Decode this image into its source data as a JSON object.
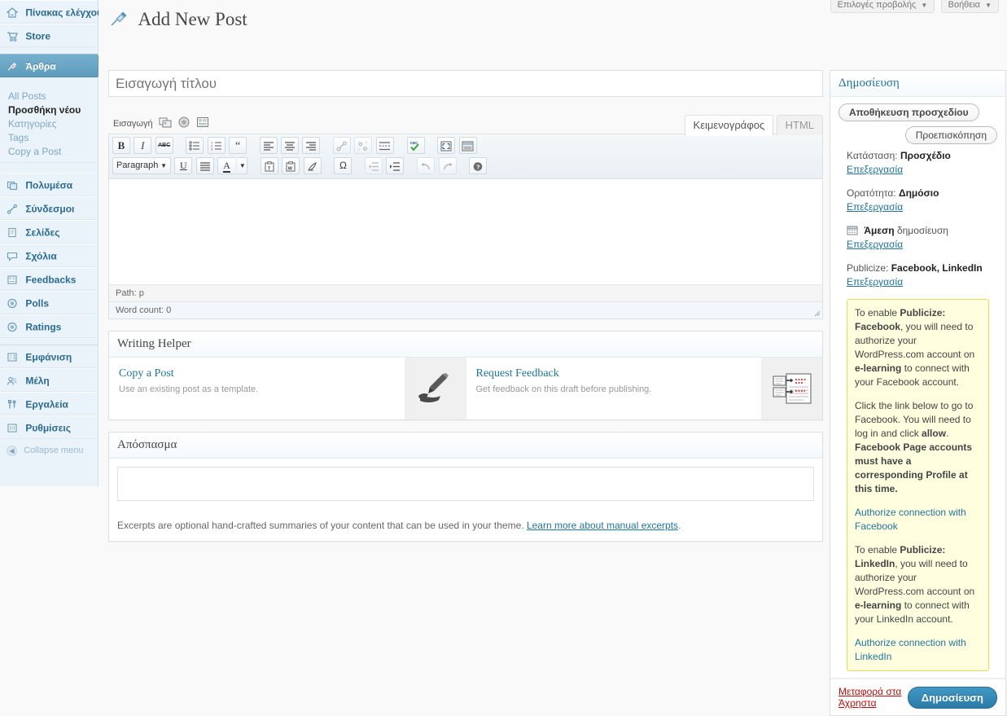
{
  "sidebar": {
    "items": [
      {
        "label": "Πίνακας ελέγχου",
        "icon": "dashboard-icon",
        "state": "normal"
      },
      {
        "label": "Store",
        "icon": "cart-icon",
        "state": "normal"
      },
      {
        "label": "Άρθρα",
        "icon": "pin-icon",
        "state": "current"
      },
      {
        "label": "Πολυμέσα",
        "icon": "media-icon",
        "state": "separator"
      },
      {
        "label": "Σύνδεσμοι",
        "icon": "link-icon",
        "state": "normal"
      },
      {
        "label": "Σελίδες",
        "icon": "page-icon",
        "state": "normal"
      },
      {
        "label": "Σχόλια",
        "icon": "comment-icon",
        "state": "normal"
      },
      {
        "label": "Feedbacks",
        "icon": "feedback-icon",
        "state": "normal"
      },
      {
        "label": "Polls",
        "icon": "poll-icon",
        "state": "normal"
      },
      {
        "label": "Ratings",
        "icon": "rating-icon",
        "state": "normal"
      },
      {
        "label": "Εμφάνιση",
        "icon": "appearance-icon",
        "state": "separator"
      },
      {
        "label": "Μέλη",
        "icon": "users-icon",
        "state": "normal"
      },
      {
        "label": "Εργαλεία",
        "icon": "tools-icon",
        "state": "normal"
      },
      {
        "label": "Ρυθμίσεις",
        "icon": "settings-icon",
        "state": "normal"
      }
    ],
    "posts_submenu": [
      {
        "label": "All Posts",
        "current": false
      },
      {
        "label": "Προσθήκη νέου",
        "current": true
      },
      {
        "label": "Κατηγορίες",
        "current": false
      },
      {
        "label": "Tags",
        "current": false
      },
      {
        "label": "Copy a Post",
        "current": false
      }
    ],
    "collapse_label": "Collapse menu",
    "collapse_icon": "chevron-left-icon"
  },
  "screen_meta": {
    "screen_options_label": "Επιλογές προβολής",
    "help_label": "Βοήθεια",
    "arrow": "▼"
  },
  "header": {
    "title": "Add New Post",
    "icon": "pin-icon"
  },
  "title_field": {
    "placeholder": "Εισαγωγή τίτλου",
    "value": ""
  },
  "editor": {
    "media_label": "Εισαγωγή",
    "media_icons": [
      "add-media-icon",
      "add-poll-icon",
      "add-contact-form-icon"
    ],
    "tabs": [
      {
        "label": "Κειμενογράφος",
        "active": true
      },
      {
        "label": "HTML",
        "active": false
      }
    ],
    "toolbar_row1": [
      {
        "icon": "bold-icon",
        "glyph": "B",
        "style": "bold-serif",
        "dim": false
      },
      {
        "icon": "italic-icon",
        "glyph": "I",
        "style": "italic-serif",
        "dim": false
      },
      {
        "icon": "strikethrough-icon",
        "glyph": "ABC",
        "style": "strike-tiny",
        "dim": false
      },
      {
        "gap": true
      },
      {
        "icon": "bulleted-list-icon",
        "glyph": "",
        "style": "ul",
        "dim": false
      },
      {
        "icon": "numbered-list-icon",
        "glyph": "",
        "style": "ol",
        "dim": false
      },
      {
        "icon": "blockquote-icon",
        "glyph": "❝",
        "style": "quote",
        "dim": false
      },
      {
        "gap": true
      },
      {
        "icon": "align-left-icon",
        "glyph": "",
        "style": "alignleft",
        "dim": false
      },
      {
        "icon": "align-center-icon",
        "glyph": "",
        "style": "aligncenter",
        "dim": false
      },
      {
        "icon": "align-right-icon",
        "glyph": "",
        "style": "alignright",
        "dim": false
      },
      {
        "gap": true
      },
      {
        "icon": "insert-link-icon",
        "glyph": "",
        "style": "link",
        "dim": true
      },
      {
        "icon": "unlink-icon",
        "glyph": "",
        "style": "unlink",
        "dim": true
      },
      {
        "icon": "insert-more-tag-icon",
        "glyph": "",
        "style": "more",
        "dim": false
      },
      {
        "gap": true
      },
      {
        "icon": "spellcheck-icon",
        "glyph": "",
        "style": "spell",
        "dim": false
      },
      {
        "gap": true
      },
      {
        "icon": "fullscreen-icon",
        "glyph": "",
        "style": "fullscreen",
        "dim": false
      },
      {
        "icon": "kitchen-sink-icon",
        "glyph": "",
        "style": "kitchensink",
        "dim": false
      }
    ],
    "format_select": {
      "value": "Paragraph",
      "arrow": "▼"
    },
    "toolbar_row2": [
      {
        "icon": "underline-icon",
        "glyph": "U",
        "style": "underline-serif",
        "dim": false
      },
      {
        "icon": "justify-icon",
        "glyph": "",
        "style": "justify",
        "dim": false
      },
      {
        "icon": "text-color-icon",
        "glyph": "A",
        "style": "textcolor",
        "dim": false,
        "split": true
      },
      {
        "gap": true
      },
      {
        "icon": "paste-as-text-icon",
        "glyph": "",
        "style": "pastetext",
        "dim": false
      },
      {
        "icon": "paste-from-word-icon",
        "glyph": "",
        "style": "pasteword",
        "dim": false
      },
      {
        "icon": "remove-formatting-icon",
        "glyph": "",
        "style": "removeformat",
        "dim": false
      },
      {
        "gap": true
      },
      {
        "icon": "special-character-icon",
        "glyph": "Ω",
        "style": "charmap",
        "dim": false
      },
      {
        "gap": true
      },
      {
        "icon": "outdent-icon",
        "glyph": "",
        "style": "outdent",
        "dim": true
      },
      {
        "icon": "indent-icon",
        "glyph": "",
        "style": "indent",
        "dim": false
      },
      {
        "gap": true
      },
      {
        "icon": "undo-icon",
        "glyph": "↺",
        "style": "undo",
        "dim": true
      },
      {
        "icon": "redo-icon",
        "glyph": "↻",
        "style": "redo",
        "dim": true
      },
      {
        "gap": true
      },
      {
        "icon": "help-icon",
        "glyph": "?",
        "style": "help",
        "dim": false
      }
    ],
    "path_label": "Path: p",
    "word_count_label": "Word count: 0",
    "content": ""
  },
  "writing_helper": {
    "title": "Writing Helper",
    "cards": [
      {
        "title": "Copy a Post",
        "subtitle": "Use an existing post as a template.",
        "icon": "pen-in-hand-icon"
      },
      {
        "title": "Request Feedback",
        "subtitle": "Get feedback on this draft before publishing.",
        "icon": "feedback-documents-icon"
      }
    ]
  },
  "excerpt": {
    "title": "Απόσπασμα",
    "value": "",
    "help_text": "Excerpts are optional hand-crafted summaries of your content that can be used in your theme.",
    "help_link": "Learn more about manual excerpts",
    "help_tail": "."
  },
  "publish_box": {
    "title": "Δημοσίευση",
    "save_draft_label": "Αποθήκευση προσχεδίου",
    "preview_label": "Προεπισκόπηση",
    "status_label": "Κατάσταση:",
    "status_value": "Προσχέδιο",
    "status_edit": "Επεξεργασία",
    "visibility_label": "Ορατότητα:",
    "visibility_value": "Δημόσιο",
    "visibility_edit": "Επεξεργασία",
    "schedule_icon": "calendar-icon",
    "schedule_value": "Άμεση",
    "schedule_label": "δημοσίευση",
    "schedule_edit": "Επεξεργασία",
    "publicize_label": "Publicize:",
    "publicize_services": "Facebook, LinkedIn",
    "publicize_edit": "Επεξεργασία",
    "notice": {
      "fb_p1_a": "To enable ",
      "fb_p1_b": "Publicize: Facebook",
      "fb_p1_c": ", you will need to authorize your WordPress.com account on ",
      "fb_p1_d": "e-learning",
      "fb_p1_e": " to connect with your Facebook account.",
      "fb_p2_a": "Click the link below to go to Facebook. You will need to log in and click ",
      "fb_p2_b": "allow",
      "fb_p2_c": ". ",
      "fb_p2_d": "Facebook Page accounts must have a corresponding Profile at this time.",
      "fb_link": "Authorize connection with Facebook",
      "li_p1_a": "To enable ",
      "li_p1_b": "Publicize: LinkedIn",
      "li_p1_c": ", you will need to authorize your WordPress.com account on ",
      "li_p1_d": "e-learning",
      "li_p1_e": " to connect with your LinkedIn account.",
      "li_link": "Authorize connection with LinkedIn"
    },
    "trash_label": "Μεταφορά στα Άχρηστα",
    "publish_label": "Δημοσίευση"
  },
  "colors": {
    "accent": "#21759b",
    "sidebar_bg": "#eaf2fa",
    "current_menu": "#5d9cbd",
    "notice_bg": "#ffffe0",
    "notice_border": "#e6db55",
    "trash_red": "#bc0b0b"
  }
}
